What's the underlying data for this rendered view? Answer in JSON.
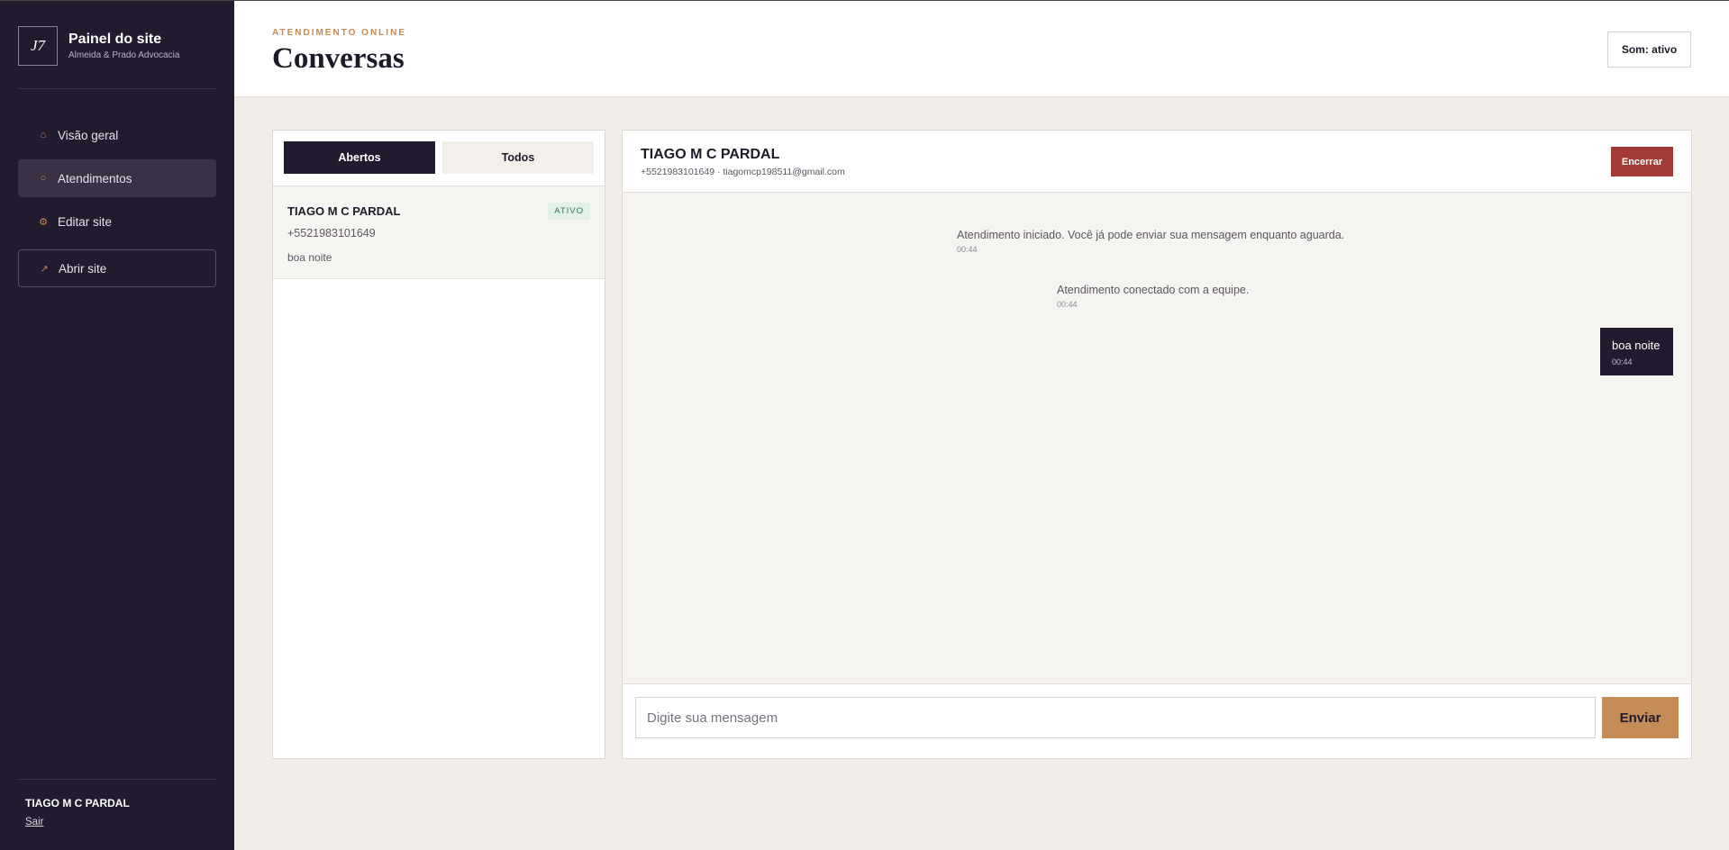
{
  "sidebar": {
    "logo": "J7",
    "brand_title": "Painel do site",
    "brand_subtitle": "Almeida & Prado Advocacia",
    "nav": [
      {
        "label": "Visão geral",
        "icon": "home-icon"
      },
      {
        "label": "Atendimentos",
        "icon": "circle-icon"
      },
      {
        "label": "Editar site",
        "icon": "gear-icon"
      },
      {
        "label": "Abrir site",
        "icon": "external-arrow-icon"
      }
    ],
    "user_name": "TIAGO M C PARDAL",
    "logout_label": "Sair"
  },
  "header": {
    "eyebrow": "ATENDIMENTO ONLINE",
    "title": "Conversas",
    "sound_button": "Som: ativo"
  },
  "list": {
    "tabs": [
      {
        "label": "Abertos",
        "active": true
      },
      {
        "label": "Todos",
        "active": false
      }
    ],
    "items": [
      {
        "name": "TIAGO M C PARDAL",
        "badge": "ATIVO",
        "phone": "+5521983101649",
        "last_message": "boa noite"
      }
    ]
  },
  "chat": {
    "name": "TIAGO M C PARDAL",
    "contact": "+5521983101649 · tiagomcp198511@gmail.com",
    "end_button": "Encerrar",
    "messages": [
      {
        "type": "system",
        "text": "Atendimento iniciado. Você já pode enviar sua mensagem enquanto aguarda.",
        "time": "00:44"
      },
      {
        "type": "system",
        "text": "Atendimento conectado com a equipe.",
        "time": "00:44"
      },
      {
        "type": "outgoing",
        "text": "boa noite",
        "time": "00:44"
      }
    ],
    "input_placeholder": "Digite sua mensagem",
    "send_button": "Enviar"
  },
  "colors": {
    "sidebar_bg": "#221a2e",
    "accent": "#c98a4e",
    "danger": "#a33a36",
    "send": "#c48c57"
  }
}
